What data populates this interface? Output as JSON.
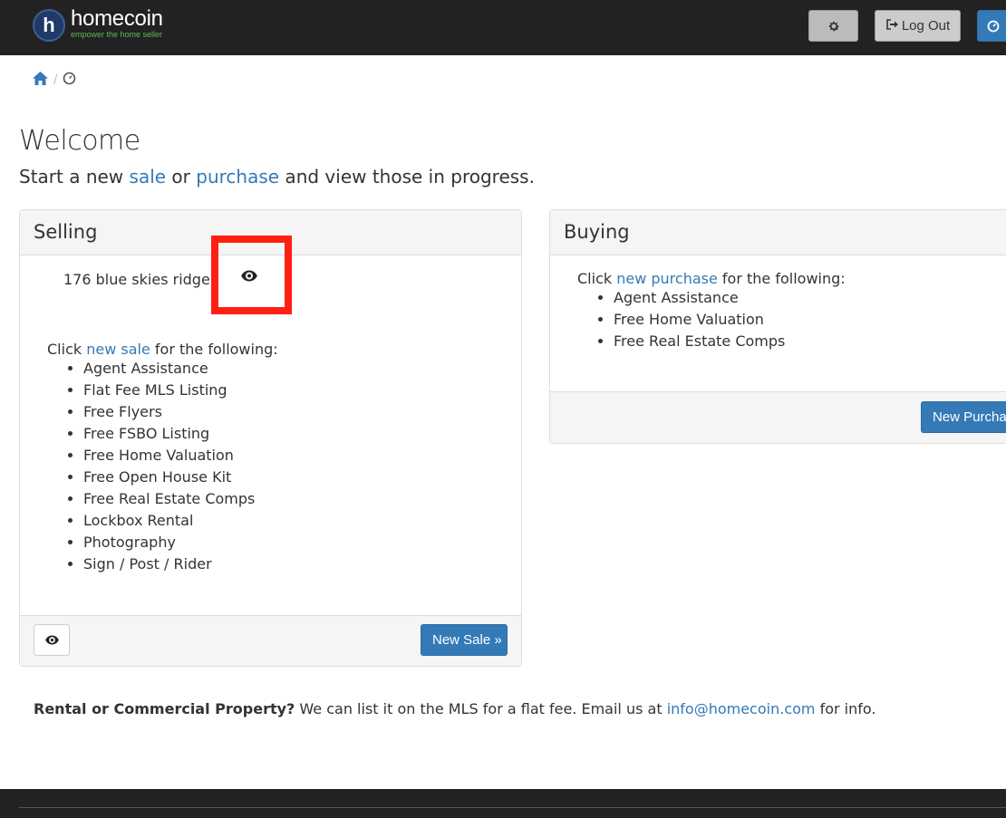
{
  "brand": {
    "logo_letter": "h",
    "name": "homecoin",
    "tagline": "empower the home seller",
    "tagline_color": "#5cb85c"
  },
  "navbar": {
    "settings_icon": "gear-icon",
    "logout_label": "Log Out",
    "logout_icon": "sign-out-icon",
    "dashboard_icon": "dashboard-icon"
  },
  "breadcrumb": {
    "home_icon": "home-icon",
    "separator": "/",
    "current_icon": "dashboard-icon"
  },
  "page": {
    "title": "Welcome",
    "lead_prefix": "Start a new ",
    "lead_sale": "sale",
    "lead_or": " or ",
    "lead_purchase": "purchase",
    "lead_suffix": " and view those in progress."
  },
  "selling": {
    "heading": "Selling",
    "property": "176 blue skies ridge",
    "view_icon": "eye-icon",
    "intro_prefix": "Click ",
    "intro_link": "new sale",
    "intro_suffix": " for the following:",
    "items": [
      "Agent Assistance",
      "Flat Fee MLS Listing",
      "Free Flyers",
      "Free FSBO Listing",
      "Free Home Valuation",
      "Free Open House Kit",
      "Free Real Estate Comps",
      "Lockbox Rental",
      "Photography",
      "Sign / Post / Rider"
    ],
    "new_sale_label": "New Sale »"
  },
  "buying": {
    "heading": "Buying",
    "intro_prefix": "Click ",
    "intro_link": "new purchase",
    "intro_suffix": " for the following:",
    "items": [
      "Agent Assistance",
      "Free Home Valuation",
      "Free Real Estate Comps"
    ],
    "new_purchase_label": "New Purchase »"
  },
  "rental": {
    "bold": "Rental or Commercial Property?",
    "text": " We can list it on the MLS for a flat fee. Email us at ",
    "email": "info@homecoin.com",
    "suffix": " for info."
  },
  "colors": {
    "primary": "#337ab7",
    "navbar": "#222222",
    "highlight": "#ff2014"
  }
}
